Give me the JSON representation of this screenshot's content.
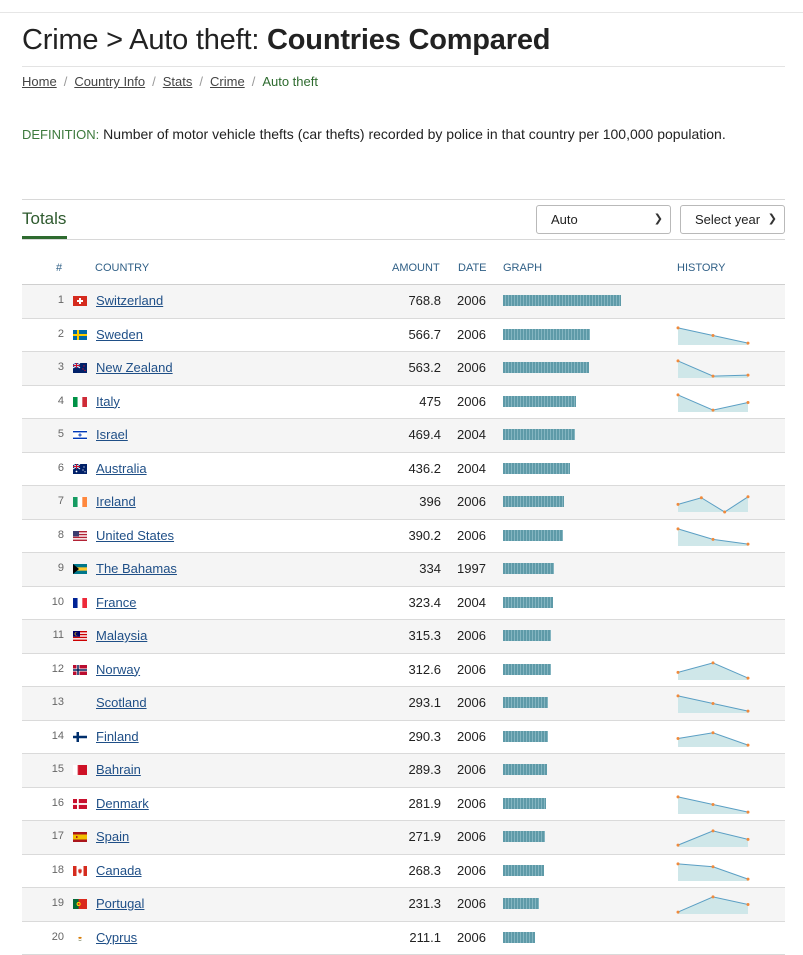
{
  "page": {
    "title_prefix": "Crime > Auto theft: ",
    "title_bold": "Countries Compared"
  },
  "breadcrumb": [
    {
      "label": "Home",
      "link": true
    },
    {
      "label": "Country Info",
      "link": true
    },
    {
      "label": "Stats",
      "link": true
    },
    {
      "label": "Crime",
      "link": true
    },
    {
      "label": "Auto theft",
      "link": false
    }
  ],
  "breadcrumb_separator": "/",
  "definition": {
    "label": "DEFINITION:",
    "text": "Number of motor vehicle thefts (car thefts) recorded by police in that country per 100,000 population."
  },
  "tabs": {
    "totals": "Totals"
  },
  "controls": {
    "scale_select": {
      "value": "Auto"
    },
    "year_select": {
      "value": "Select year"
    }
  },
  "table": {
    "headers": {
      "rank": "#",
      "country": "COUNTRY",
      "amount": "AMOUNT",
      "date": "DATE",
      "graph": "GRAPH",
      "history": "HISTORY"
    },
    "scale_max": 768.8,
    "rows": [
      {
        "rank": "1",
        "country": "Switzerland",
        "amount": 768.8,
        "date": "2006",
        "flag": "switzerland-flag-icon",
        "history": null
      },
      {
        "rank": "2",
        "country": "Sweden",
        "amount": 566.7,
        "date": "2006",
        "flag": "sweden-flag-icon",
        "history": [
          0.9,
          0.5,
          0.1
        ]
      },
      {
        "rank": "3",
        "country": "New Zealand",
        "amount": 563.2,
        "date": "2006",
        "flag": "new-zealand-flag-icon",
        "history": [
          0.9,
          0.1,
          0.15
        ]
      },
      {
        "rank": "4",
        "country": "Italy",
        "amount": 475,
        "date": "2006",
        "flag": "italy-flag-icon",
        "history": [
          0.9,
          0.1,
          0.5
        ]
      },
      {
        "rank": "5",
        "country": "Israel",
        "amount": 469.4,
        "date": "2004",
        "flag": "israel-flag-icon",
        "history": null
      },
      {
        "rank": "6",
        "country": "Australia",
        "amount": 436.2,
        "date": "2004",
        "flag": "australia-flag-icon",
        "history": null
      },
      {
        "rank": "7",
        "country": "Ireland",
        "amount": 396,
        "date": "2006",
        "flag": "ireland-flag-icon",
        "history": [
          0.4,
          0.75,
          0.0,
          0.8
        ]
      },
      {
        "rank": "8",
        "country": "United States",
        "amount": 390.2,
        "date": "2006",
        "flag": "united-states-flag-icon",
        "history": [
          0.9,
          0.35,
          0.1
        ]
      },
      {
        "rank": "9",
        "country": "The Bahamas",
        "amount": 334,
        "date": "1997",
        "flag": "bahamas-flag-icon",
        "history": null
      },
      {
        "rank": "10",
        "country": "France",
        "amount": 323.4,
        "date": "2004",
        "flag": "france-flag-icon",
        "history": null
      },
      {
        "rank": "11",
        "country": "Malaysia",
        "amount": 315.3,
        "date": "2006",
        "flag": "malaysia-flag-icon",
        "history": null
      },
      {
        "rank": "12",
        "country": "Norway",
        "amount": 312.6,
        "date": "2006",
        "flag": "norway-flag-icon",
        "history": [
          0.4,
          0.9,
          0.1
        ]
      },
      {
        "rank": "13",
        "country": "Scotland",
        "amount": 293.1,
        "date": "2006",
        "flag": "",
        "history": [
          0.9,
          0.5,
          0.1
        ]
      },
      {
        "rank": "14",
        "country": "Finland",
        "amount": 290.3,
        "date": "2006",
        "flag": "finland-flag-icon",
        "history": [
          0.45,
          0.75,
          0.1
        ]
      },
      {
        "rank": "15",
        "country": "Bahrain",
        "amount": 289.3,
        "date": "2006",
        "flag": "bahrain-flag-icon",
        "history": null
      },
      {
        "rank": "16",
        "country": "Denmark",
        "amount": 281.9,
        "date": "2006",
        "flag": "denmark-flag-icon",
        "history": [
          0.9,
          0.5,
          0.1
        ]
      },
      {
        "rank": "17",
        "country": "Spain",
        "amount": 271.9,
        "date": "2006",
        "flag": "spain-flag-icon",
        "history": [
          0.1,
          0.85,
          0.4
        ]
      },
      {
        "rank": "18",
        "country": "Canada",
        "amount": 268.3,
        "date": "2006",
        "flag": "canada-flag-icon",
        "history": [
          0.9,
          0.75,
          0.1
        ]
      },
      {
        "rank": "19",
        "country": "Portugal",
        "amount": 231.3,
        "date": "2006",
        "flag": "portugal-flag-icon",
        "history": [
          0.1,
          0.9,
          0.5
        ]
      },
      {
        "rank": "20",
        "country": "Cyprus",
        "amount": 211.1,
        "date": "2006",
        "flag": "cyprus-flag-icon",
        "history": null
      }
    ]
  },
  "colors": {
    "link": "#1f4f87",
    "accent_green": "#2e6b2f",
    "header_blue": "#2f5f86",
    "bar": "#5e9aa8",
    "history_line": "#5b9fc4",
    "history_fill": "#cfe7e9",
    "history_dot": "#f08a3c"
  }
}
